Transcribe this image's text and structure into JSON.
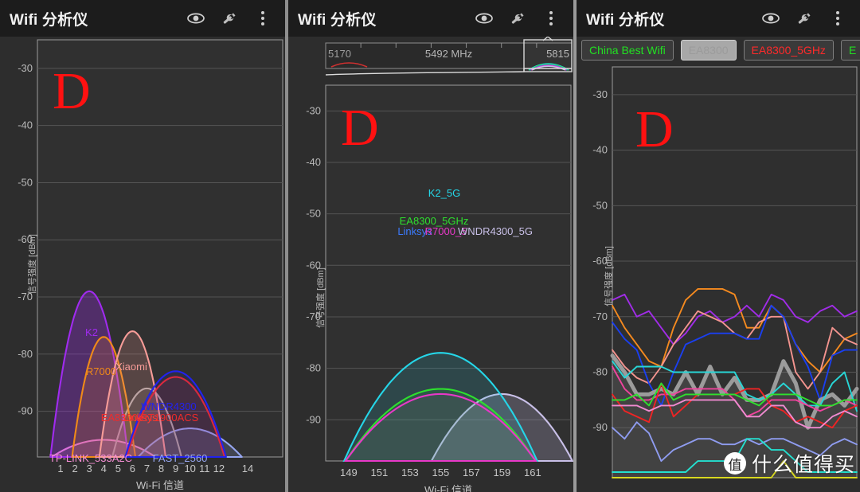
{
  "app": {
    "title": "Wifi 分析仪",
    "icons": [
      "eye-icon",
      "wrench-icon",
      "overflow-menu-icon"
    ]
  },
  "watermark": {
    "badge": "值",
    "text": "什么值得买",
    "overlay_letter": "D"
  },
  "panel1": {
    "name": "2.4GHz channel graph",
    "ylabel": "信号强度 [dBm]",
    "xlabel": "Wi-Fi 信道",
    "yticks": [
      "-30",
      "-40",
      "-50",
      "-60",
      "-70",
      "-80",
      "-90"
    ],
    "xticks": [
      "1",
      "2",
      "3",
      "4",
      "5",
      "6",
      "7",
      "8",
      "9",
      "10",
      "11",
      "12",
      "14"
    ],
    "networks": [
      {
        "label": "K2",
        "color": "#a02bef",
        "channel": 3,
        "level": -69
      },
      {
        "label": "R7000",
        "color": "#f08a18",
        "channel": 4,
        "level": -77
      },
      {
        "label": "Xiaomi",
        "color": "#f79c98",
        "channel": 6,
        "level": -76
      },
      {
        "label": "WNDR4300",
        "color": "#2222ee",
        "channel": 9,
        "level": -83
      },
      {
        "label": "Linksys",
        "color": "#ff3b2e",
        "channel": 7,
        "level": -85
      },
      {
        "label": "EA8300/RT1900ACS",
        "color": "#ef2b2b",
        "channel": 9,
        "level": -84
      },
      {
        "label": "FAST_2560",
        "color": "#96a6f0",
        "channel": 10,
        "level": -93
      },
      {
        "label": "TP-LINK_533A2C",
        "color": "#f78fd6",
        "channel": 4,
        "level": -95
      },
      {
        "label": "",
        "color": "#b0a8a8",
        "channel": 7,
        "level": -86
      }
    ]
  },
  "panel2": {
    "name": "5GHz channel graph",
    "ylabel": "信号强度 [dBm]",
    "xlabel": "Wi-Fi 信道",
    "yticks": [
      "-30",
      "-40",
      "-50",
      "-60",
      "-70",
      "-80",
      "-90"
    ],
    "xticks": [
      "149",
      "151",
      "153",
      "155",
      "157",
      "159",
      "161"
    ],
    "navigator": {
      "left": "5170",
      "center": "5492 MHz",
      "right": "5815"
    },
    "networks": [
      {
        "label": "K2_5G",
        "color": "#25d6e8",
        "channel": 155,
        "level": -77
      },
      {
        "label": "EA8300_5GHz",
        "color": "#2ee02e",
        "channel": 155,
        "level": -84
      },
      {
        "label": "Linksys",
        "color": "#3b7bff",
        "channel": 155,
        "level": -85
      },
      {
        "label": "R7000_5",
        "color": "#e838c8",
        "channel": 155,
        "level": -85
      },
      {
        "label": "WNDR4300_5G",
        "color": "#c9c0e8",
        "channel": 159,
        "level": -85
      }
    ]
  },
  "panel3": {
    "name": "time graph",
    "ylabel": "信号强度 [dBm]",
    "yticks": [
      "-30",
      "-40",
      "-50",
      "-60",
      "-70",
      "-80",
      "-90"
    ],
    "filters": [
      {
        "label": "China Best Wifi",
        "color": "#22e022",
        "state": "on"
      },
      {
        "label": "EA8300",
        "color": "#8f8f8f",
        "state": "off"
      },
      {
        "label": "EA8300_5GHz",
        "color": "#ff2a2a",
        "state": "on"
      },
      {
        "label": "E",
        "color": "#22e022",
        "state": "on"
      }
    ],
    "series": [
      {
        "name": "orange",
        "color": "#f58a1f",
        "values": [
          -68,
          -72,
          -75,
          -78,
          -79,
          -72,
          -67,
          -65,
          -65,
          -65,
          -66,
          -72,
          -72,
          -68,
          -70,
          -75,
          -78,
          -80,
          -77,
          -74,
          -73
        ]
      },
      {
        "name": "purple",
        "color": "#a12ce8",
        "values": [
          -67,
          -66,
          -70,
          -69,
          -72,
          -75,
          -73,
          -70,
          -69,
          -71,
          -70,
          -68,
          -70,
          -66,
          -67,
          -70,
          -71,
          -69,
          -68,
          -70,
          -69
        ]
      },
      {
        "name": "salmon",
        "color": "#f3948f",
        "values": [
          -76,
          -79,
          -81,
          -82,
          -79,
          -75,
          -72,
          -69,
          -70,
          -71,
          -73,
          -74,
          -71,
          -70,
          -70,
          -80,
          -83,
          -80,
          -72,
          -74,
          -75
        ]
      },
      {
        "name": "blue",
        "color": "#1a3ff0",
        "values": [
          -71,
          -74,
          -76,
          -82,
          -86,
          -80,
          -75,
          -74,
          -73,
          -73,
          -73,
          -74,
          -74,
          -68,
          -70,
          -75,
          -79,
          -85,
          -77,
          -76,
          -76
        ]
      },
      {
        "name": "grey-thick",
        "color": "#9b9b9b",
        "values": [
          -77,
          -80,
          -84,
          -84,
          -83,
          -84,
          -80,
          -84,
          -79,
          -84,
          -81,
          -85,
          -85,
          -84,
          -78,
          -82,
          -90,
          -85,
          -84,
          -86,
          -83
        ]
      },
      {
        "name": "cyan",
        "color": "#28d6d6",
        "values": [
          -78,
          -81,
          -79,
          -79,
          -79,
          -80,
          -80,
          -80,
          -80,
          -80,
          -80,
          -84,
          -85,
          -84,
          -82,
          -84,
          -86,
          -86,
          -82,
          -80,
          -87
        ]
      },
      {
        "name": "magenta",
        "color": "#f0439e",
        "values": [
          -79,
          -83,
          -85,
          -85,
          -84,
          -84,
          -83,
          -83,
          -83,
          -83,
          -85,
          -88,
          -87,
          -85,
          -85,
          -85,
          -86,
          -87,
          -86,
          -85,
          -86
        ]
      },
      {
        "name": "red",
        "color": "#ef2424",
        "values": [
          -84,
          -87,
          -88,
          -89,
          -82,
          -88,
          -86,
          -84,
          -84,
          -84,
          -84,
          -83,
          -83,
          -86,
          -87,
          -89,
          -88,
          -89,
          -90,
          -87,
          -86
        ]
      },
      {
        "name": "green",
        "color": "#2ee02e",
        "values": [
          -85,
          -85,
          -84,
          -86,
          -82,
          -85,
          -84,
          -84,
          -84,
          -84,
          -84,
          -85,
          -86,
          -84,
          -84,
          -84,
          -85,
          -86,
          -86,
          -85,
          -85
        ]
      },
      {
        "name": "pink",
        "color": "#f08ad0",
        "values": [
          -86,
          -86,
          -86,
          -87,
          -86,
          -86,
          -85,
          -85,
          -85,
          -85,
          -85,
          -88,
          -88,
          -86,
          -86,
          -89,
          -90,
          -90,
          -88,
          -87,
          -88
        ]
      },
      {
        "name": "periwinkle",
        "color": "#8f9cf0",
        "values": [
          -90,
          -92,
          -89,
          -91,
          -96,
          -94,
          -93,
          -92,
          -92,
          -93,
          -93,
          -92,
          -93,
          -92,
          -92,
          -93,
          -94,
          -95,
          -93,
          -92,
          -93
        ]
      },
      {
        "name": "teal-low",
        "color": "#24e0d0",
        "values": [
          -98,
          -98,
          -98,
          -98,
          -98,
          -98,
          -98,
          -96,
          -96,
          -96,
          -96,
          -92,
          -92,
          -94,
          -94,
          -96,
          -98,
          -98,
          -98,
          -98,
          -98
        ]
      },
      {
        "name": "yellow-low",
        "color": "#d8d820",
        "values": [
          -99,
          -99,
          -99,
          -99,
          -99,
          -99,
          -99,
          -99,
          -99,
          -99,
          -99,
          -99,
          -99,
          -99,
          -96,
          -99,
          -99,
          -99,
          -99,
          -99,
          -99
        ]
      }
    ]
  }
}
